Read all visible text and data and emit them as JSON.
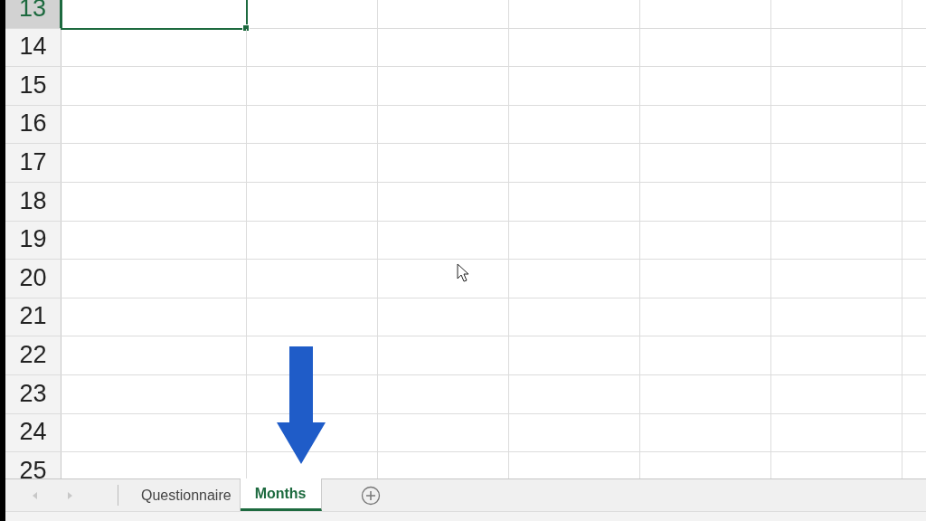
{
  "rows": [
    {
      "number": "13",
      "selected": true
    },
    {
      "number": "14",
      "selected": false
    },
    {
      "number": "15",
      "selected": false
    },
    {
      "number": "16",
      "selected": false
    },
    {
      "number": "17",
      "selected": false
    },
    {
      "number": "18",
      "selected": false
    },
    {
      "number": "19",
      "selected": false
    },
    {
      "number": "20",
      "selected": false
    },
    {
      "number": "21",
      "selected": false
    },
    {
      "number": "22",
      "selected": false
    },
    {
      "number": "23",
      "selected": false
    },
    {
      "number": "24",
      "selected": false
    },
    {
      "number": "25",
      "selected": false
    }
  ],
  "sheet_tabs": [
    {
      "label": "Questionnaire",
      "selected": false
    },
    {
      "label": "Months",
      "selected": true
    }
  ]
}
